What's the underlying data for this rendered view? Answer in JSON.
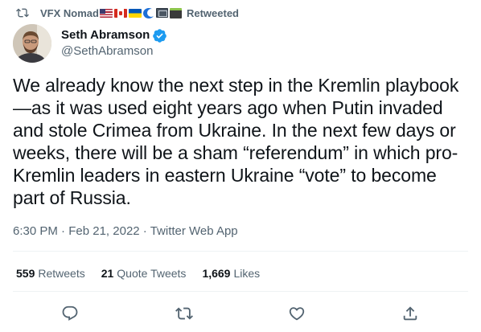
{
  "social_context": {
    "retweeter_name": "VFX Nomad",
    "retweeter_emoji": [
      "us-flag",
      "canada-flag",
      "ukraine-flag",
      "crescent-moon",
      "ticket",
      "clapperboard"
    ],
    "label": "Retweeted"
  },
  "author": {
    "display_name": "Seth Abramson",
    "handle": "@SethAbramson",
    "verified": true
  },
  "tweet": {
    "text": "We already know the next step in the Kremlin playbook—as it was used eight years ago when Putin invaded and stole Crimea from Ukraine. In the next few days or weeks, there will be a sham “referendum” in which pro-Kremlin leaders in eastern Ukraine “vote” to become part of Russia.",
    "time": "6:30 PM",
    "date": "Feb 21, 2022",
    "source": "Twitter Web App"
  },
  "stats": {
    "retweets_count": "559",
    "retweets_label": "Retweets",
    "quotes_count": "21",
    "quotes_label": "Quote Tweets",
    "likes_count": "1,669",
    "likes_label": "Likes"
  },
  "colors": {
    "text_primary": "#0f1419",
    "text_secondary": "#536471",
    "verified_badge": "#1d9bf0",
    "divider": "#eff3f4"
  },
  "icons": {
    "retweet": "retweet-icon",
    "verified": "verified-badge-icon",
    "reply": "reply-icon",
    "like": "heart-icon",
    "share": "share-icon"
  }
}
